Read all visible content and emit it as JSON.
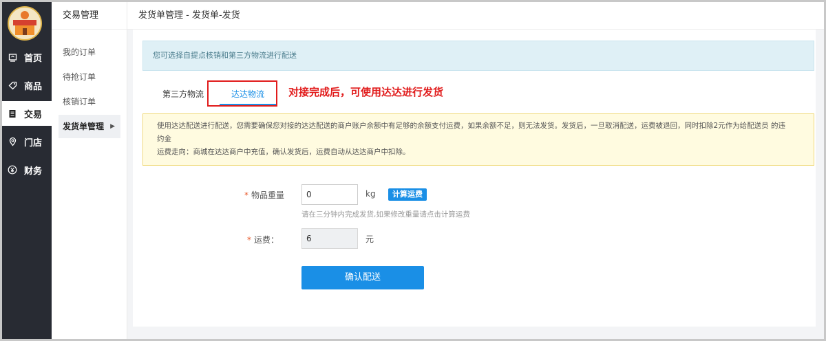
{
  "nav": {
    "items": [
      {
        "label": "首页",
        "icon": "home-icon"
      },
      {
        "label": "商品",
        "icon": "tag-icon"
      },
      {
        "label": "交易",
        "icon": "document-icon"
      },
      {
        "label": "门店",
        "icon": "location-icon"
      },
      {
        "label": "财务",
        "icon": "yen-icon"
      }
    ],
    "active_index": 2
  },
  "submenu": {
    "title": "交易管理",
    "items": [
      {
        "label": "我的订单"
      },
      {
        "label": "待抢订单"
      },
      {
        "label": "核销订单"
      },
      {
        "label": "发货单管理"
      }
    ]
  },
  "header": {
    "breadcrumb": "发货单管理 - 发货单-发货"
  },
  "notice": {
    "text": "您可选择自提点核销和第三方物流进行配送"
  },
  "tabs": [
    {
      "label": "第三方物流"
    },
    {
      "label": "达达物流"
    }
  ],
  "annotation": {
    "text": "对接完成后，可使用达达进行发货"
  },
  "warning": {
    "line1": "使用达达配送进行配送，您需要确保您对接的达达配送的商户账户余额中有足够的余额支付运费，如果余额不足，则无法发货。发货后，一旦取消配送，运费被退回，同时扣除2元作为给配送员 的违",
    "line2": "约金",
    "line3": "运费走向：商城在达达商户中充值，确认发货后，运费自动从达达商户中扣除。"
  },
  "form": {
    "weight": {
      "label": "物品重量",
      "required_mark": "*",
      "value": "0",
      "unit": "kg",
      "calc_label": "计算运费",
      "hint": "请在三分钟内完成发货,如果修改重量请点击计算运费"
    },
    "fee": {
      "label": "运费：",
      "required_mark": "*",
      "value": "6",
      "unit": "元"
    },
    "submit_label": "确认配送"
  },
  "colors": {
    "nav_bg": "#282b33",
    "accent": "#1a8fe6",
    "annotation": "#e11b1b"
  }
}
